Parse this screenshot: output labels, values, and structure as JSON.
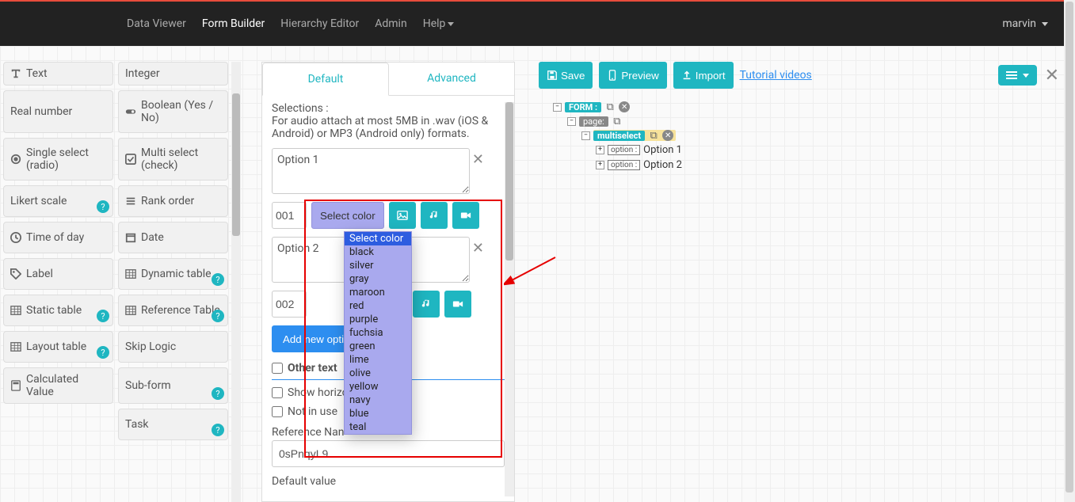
{
  "nav": {
    "items": [
      {
        "label": "Data Viewer",
        "active": false
      },
      {
        "label": "Form Builder",
        "active": true
      },
      {
        "label": "Hierarchy Editor",
        "active": false
      },
      {
        "label": "Admin",
        "active": false
      },
      {
        "label": "Help",
        "active": false,
        "dropdown": true
      }
    ],
    "user": "marvin"
  },
  "palette": [
    {
      "label": "Text",
      "icon": "text",
      "help": false
    },
    {
      "label": "Integer",
      "icon": "",
      "help": false
    },
    {
      "label": "Real number",
      "icon": "",
      "help": false
    },
    {
      "label": "Boolean (Yes / No)",
      "icon": "toggle",
      "help": false
    },
    {
      "label": "Single select (radio)",
      "icon": "radio",
      "help": false
    },
    {
      "label": "Multi select (check)",
      "icon": "check",
      "help": false
    },
    {
      "label": "Likert scale",
      "icon": "",
      "help": true
    },
    {
      "label": "Rank order",
      "icon": "list",
      "help": false
    },
    {
      "label": "Time of day",
      "icon": "clock",
      "help": false
    },
    {
      "label": "Date",
      "icon": "calendar",
      "help": false
    },
    {
      "label": "Label",
      "icon": "tag",
      "help": false
    },
    {
      "label": "Dynamic table",
      "icon": "table",
      "help": true
    },
    {
      "label": "Static table",
      "icon": "table",
      "help": true
    },
    {
      "label": "Reference Table",
      "icon": "table",
      "help": true
    },
    {
      "label": "Layout table",
      "icon": "table",
      "help": true
    },
    {
      "label": "Skip Logic",
      "icon": "",
      "help": false
    },
    {
      "label": "Calculated Value",
      "icon": "calc",
      "help": false
    },
    {
      "label": "Sub-form",
      "icon": "",
      "help": true
    },
    {
      "label": "Task",
      "icon": "",
      "help": true
    }
  ],
  "editor": {
    "tabs": [
      {
        "label": "Default",
        "active": true
      },
      {
        "label": "Advanced",
        "active": false
      }
    ],
    "intro_line1": "Selections :",
    "intro_line2": "For audio attach at most 5MB in .wav (iOS & Android) or MP3 (Android only) formats.",
    "options": [
      {
        "text": "Option 1",
        "code": "001"
      },
      {
        "text": "Option 2",
        "code": "002"
      }
    ],
    "color_button_label": "Select color",
    "color_options": [
      "Select color",
      "black",
      "silver",
      "gray",
      "maroon",
      "red",
      "purple",
      "fuchsia",
      "green",
      "lime",
      "olive",
      "yellow",
      "navy",
      "blue",
      "teal"
    ],
    "add_option_label": "Add new option",
    "other_text_label": "Other text",
    "show_horizontal_label": "Show horizo",
    "not_in_use_label": "Not in use",
    "reference_name_label": "Reference Nan",
    "reference_name_value": "0sPnqyL9",
    "default_value_label": "Default value"
  },
  "rightpanel": {
    "save": "Save",
    "preview": "Preview",
    "import": "Import",
    "tutorial": "Tutorial videos"
  },
  "tree": {
    "form_label": "FORM :",
    "page_label": "page:",
    "multiselect_label": "multiselect",
    "options": [
      {
        "badge": "option :",
        "label": "Option 1"
      },
      {
        "badge": "option :",
        "label": "Option 2"
      }
    ]
  }
}
